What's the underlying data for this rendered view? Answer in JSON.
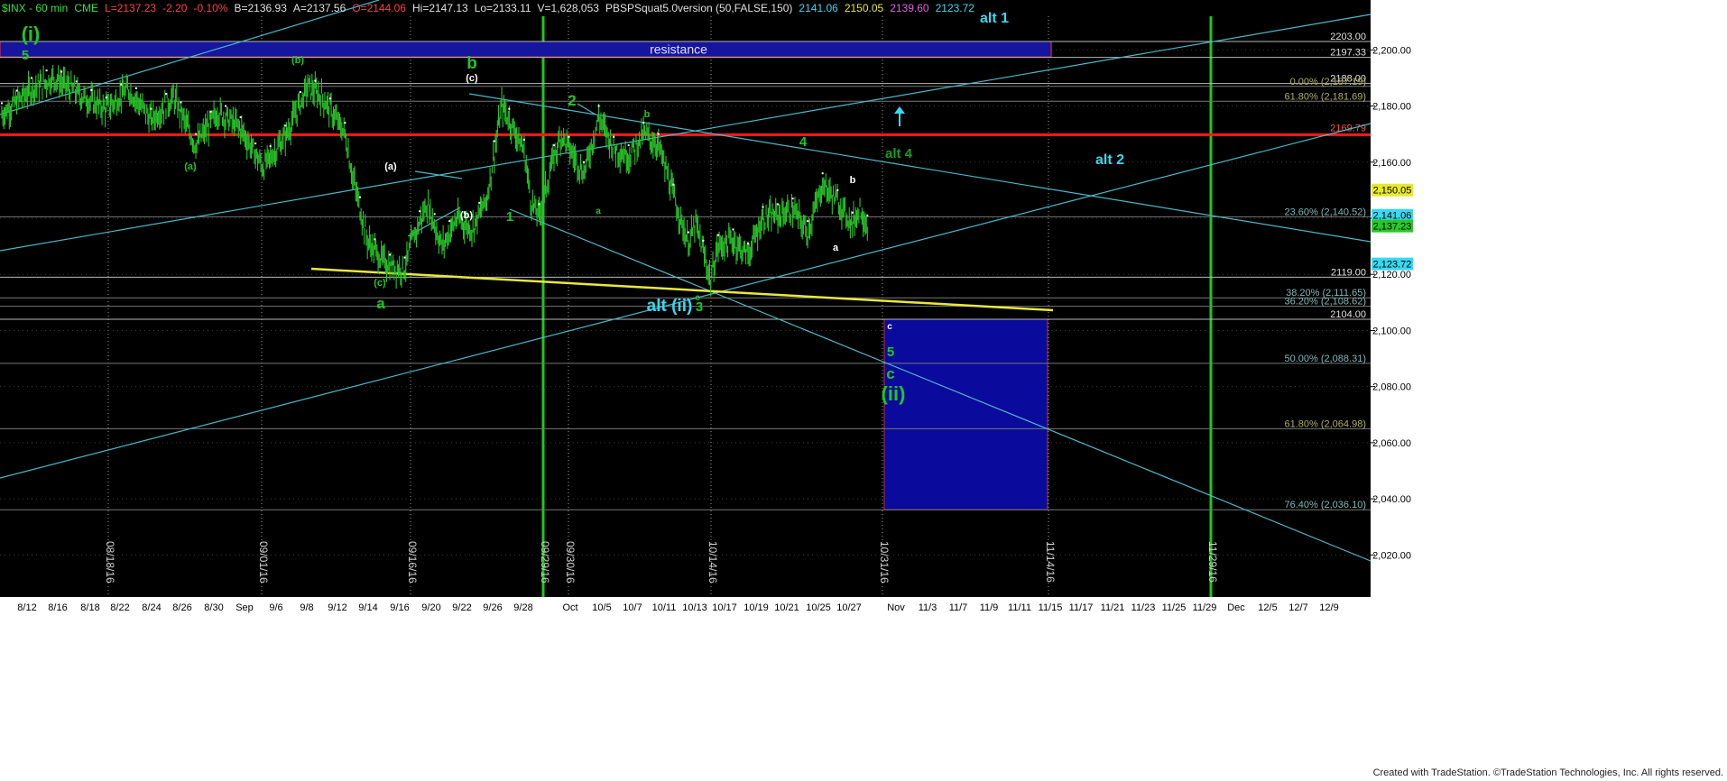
{
  "header": {
    "symbol": "$INX - 60 min",
    "exchange": "CME",
    "last": "L=2137.23",
    "change": "-2.20",
    "change_pct": "-0.10%",
    "bid": "B=2136.93",
    "ask": "A=2137.56",
    "open": "O=2144.06",
    "high": "Hi=2147.13",
    "low": "Lo=2133.11",
    "volume": "V=1,628,053",
    "study": "PBSPSquat5.0version (50,FALSE,150)",
    "study_values": [
      "2141.06",
      "2150.05",
      "2139.60",
      "2123.72"
    ]
  },
  "footer": "Created with TradeStation. ©TradeStation Technologies, Inc. All rights reserved.",
  "colors": {
    "background": "#000000",
    "bars": "#27c427",
    "resistance_fill": "#15159e",
    "support_fill": "#0a0a9c",
    "red_line": "#ff1a1a",
    "channel": "#4ab8c8",
    "yellow": "#e8e83c",
    "vgreen": "#1ec81e",
    "axis_bg": "#ffffff"
  },
  "chart_data": {
    "type": "candlestick",
    "title": "$INX - 60 min",
    "ylim": [
      2005,
      2212
    ],
    "y_ticks": [
      2020,
      2040,
      2060,
      2080,
      2100,
      2120,
      2140,
      2160,
      2180,
      2200
    ],
    "y_tick_labels": [
      "2,020.00",
      "2,040.00",
      "2,060.00",
      "2,080.00",
      "2,100.00",
      "2,120.00",
      "2,140.00",
      "2,160.00",
      "2,180.00",
      "2,200.00"
    ],
    "x_tick_labels": [
      "8/12",
      "8/16",
      "8/18",
      "8/22",
      "8/24",
      "8/26",
      "8/30",
      "Sep",
      "9/6",
      "9/8",
      "9/12",
      "9/14",
      "9/16",
      "9/20",
      "9/22",
      "9/26",
      "9/28",
      "Oct",
      "10/5",
      "10/7",
      "10/11",
      "10/13",
      "10/17",
      "10/19",
      "10/21",
      "10/25",
      "10/27",
      "Nov",
      "11/3",
      "11/7",
      "11/9",
      "11/11",
      "11/15",
      "11/17",
      "11/21",
      "11/23",
      "11/25",
      "11/29",
      "Dec",
      "12/5",
      "12/7",
      "12/9"
    ],
    "vertical_date_labels": [
      "08/18/16",
      "09/01/16",
      "09/16/16",
      "09/29/16",
      "09/30/16",
      "10/14/16",
      "10/31/16",
      "11/14/16",
      "11/29/16"
    ],
    "price_path": [
      [
        0,
        2177
      ],
      [
        4,
        2186
      ],
      [
        7,
        2190
      ],
      [
        11,
        2183
      ],
      [
        14,
        2179
      ],
      [
        17,
        2186
      ],
      [
        20,
        2175
      ],
      [
        23,
        2183
      ],
      [
        26,
        2166
      ],
      [
        29,
        2178
      ],
      [
        32,
        2172
      ],
      [
        35,
        2158
      ],
      [
        38,
        2169
      ],
      [
        41,
        2187
      ],
      [
        43,
        2183
      ],
      [
        46,
        2170
      ],
      [
        47,
        2155
      ],
      [
        49,
        2132
      ],
      [
        51,
        2125
      ],
      [
        52,
        2123
      ],
      [
        54,
        2122
      ],
      [
        55,
        2132
      ],
      [
        57,
        2145
      ],
      [
        59,
        2130
      ],
      [
        61,
        2140
      ],
      [
        63,
        2136
      ],
      [
        65,
        2147
      ],
      [
        67,
        2180
      ],
      [
        68,
        2175
      ],
      [
        70,
        2164
      ],
      [
        71,
        2145
      ],
      [
        72,
        2141
      ],
      [
        74,
        2162
      ],
      [
        75,
        2170
      ],
      [
        76,
        2165
      ],
      [
        78,
        2156
      ],
      [
        80,
        2176
      ],
      [
        82,
        2165
      ],
      [
        84,
        2162
      ],
      [
        86,
        2170
      ],
      [
        88,
        2166
      ],
      [
        90,
        2148
      ],
      [
        92,
        2131
      ],
      [
        93,
        2138
      ],
      [
        94,
        2128
      ],
      [
        95,
        2118
      ],
      [
        96,
        2130
      ],
      [
        98,
        2132
      ],
      [
        100,
        2127
      ],
      [
        102,
        2140
      ],
      [
        104,
        2141
      ],
      [
        106,
        2143
      ],
      [
        108,
        2135
      ],
      [
        110,
        2152
      ],
      [
        112,
        2146
      ],
      [
        114,
        2138
      ],
      [
        115,
        2144
      ],
      [
        116,
        2137
      ]
    ],
    "horizontal_levels": [
      {
        "value": 2203.0,
        "label": "2203.00"
      },
      {
        "value": 2197.33,
        "label": "2197.33"
      },
      {
        "value": 2188.0,
        "label": "2188.00"
      },
      {
        "value": 2187.0,
        "label": "0.00% (2,187.19)"
      },
      {
        "value": 2181.69,
        "label": "61.80% (2,181.69)"
      },
      {
        "value": 2140.52,
        "label": "23.60% (2,140.52)"
      },
      {
        "value": 2119.0,
        "label": "2119.00"
      },
      {
        "value": 2111.65,
        "label": "38.20% (2,111.65)"
      },
      {
        "value": 2108.62,
        "label": "36.20% (2,108.62)"
      },
      {
        "value": 2104.0,
        "label": "2104.00"
      },
      {
        "value": 2088.31,
        "label": "50.00% (2,088.31)"
      },
      {
        "value": 2064.98,
        "label": "61.80% (2,064.98)"
      },
      {
        "value": 2036.1,
        "label": "76.40% (2,036.10)"
      }
    ],
    "red_level": {
      "value": 2169.79,
      "label": "2169.79"
    },
    "resistance_box": {
      "high": 2203.0,
      "low": 2197.5,
      "label": "resistance"
    },
    "target_box": {
      "high": 2104.0,
      "low": 2036.1
    },
    "price_flags": [
      {
        "value": 2150.05,
        "label": "2,150.05",
        "bg": "#e8e82a",
        "fg": "#000000"
      },
      {
        "value": 2141.06,
        "label": "2,141.06",
        "bg": "#39d8f0",
        "fg": "#000000"
      },
      {
        "value": 2137.23,
        "label": "2,137.23",
        "bg": "#28c828",
        "fg": "#000000"
      },
      {
        "value": 2123.72,
        "label": "2,123.72",
        "bg": "#39d8f0",
        "fg": "#000000"
      }
    ],
    "wave_labels": [
      {
        "text": "(i)",
        "color": "#1ec81e",
        "size": 22
      },
      {
        "text": "5",
        "color": "#1ec81e",
        "size": 15
      },
      {
        "text": "(b)",
        "color": "#1ec81e",
        "size": 11
      },
      {
        "text": "(a)",
        "color": "#1ec81e",
        "size": 11
      },
      {
        "text": "(a)",
        "color": "#ffffff",
        "size": 11
      },
      {
        "text": "(b)",
        "color": "#ffffff",
        "size": 11
      },
      {
        "text": "(c)",
        "color": "#1ec81e",
        "size": 11
      },
      {
        "text": "a",
        "color": "#1ec81e",
        "size": 17
      },
      {
        "text": "b",
        "color": "#1ec81e",
        "size": 19
      },
      {
        "text": "(c)",
        "color": "#ffffff",
        "size": 11
      },
      {
        "text": "1",
        "color": "#1ec81e",
        "size": 15
      },
      {
        "text": "2",
        "color": "#1ec81e",
        "size": 17
      },
      {
        "text": "a",
        "color": "#1ec81e",
        "size": 10
      },
      {
        "text": "b",
        "color": "#1ec81e",
        "size": 11
      },
      {
        "text": "c",
        "color": "#1ec81e",
        "size": 10
      },
      {
        "text": "3",
        "color": "#1ec81e",
        "size": 15
      },
      {
        "text": "alt (ii)",
        "color": "#39d8f0",
        "size": 19
      },
      {
        "text": "4",
        "color": "#1ec81e",
        "size": 15
      },
      {
        "text": "alt 4",
        "color": "#1e9c1e",
        "size": 15
      },
      {
        "text": "b",
        "color": "#ffffff",
        "size": 11
      },
      {
        "text": "a",
        "color": "#ffffff",
        "size": 11
      },
      {
        "text": "c",
        "color": "#ffffff",
        "size": 10
      },
      {
        "text": "5",
        "color": "#1ec81e",
        "size": 15
      },
      {
        "text": "c",
        "color": "#1ec81e",
        "size": 17
      },
      {
        "text": "(ii)",
        "color": "#1ec81e",
        "size": 22
      },
      {
        "text": "alt 1",
        "color": "#39d8f0",
        "size": 16
      },
      {
        "text": "alt 2",
        "color": "#39d8f0",
        "size": 16
      }
    ]
  }
}
